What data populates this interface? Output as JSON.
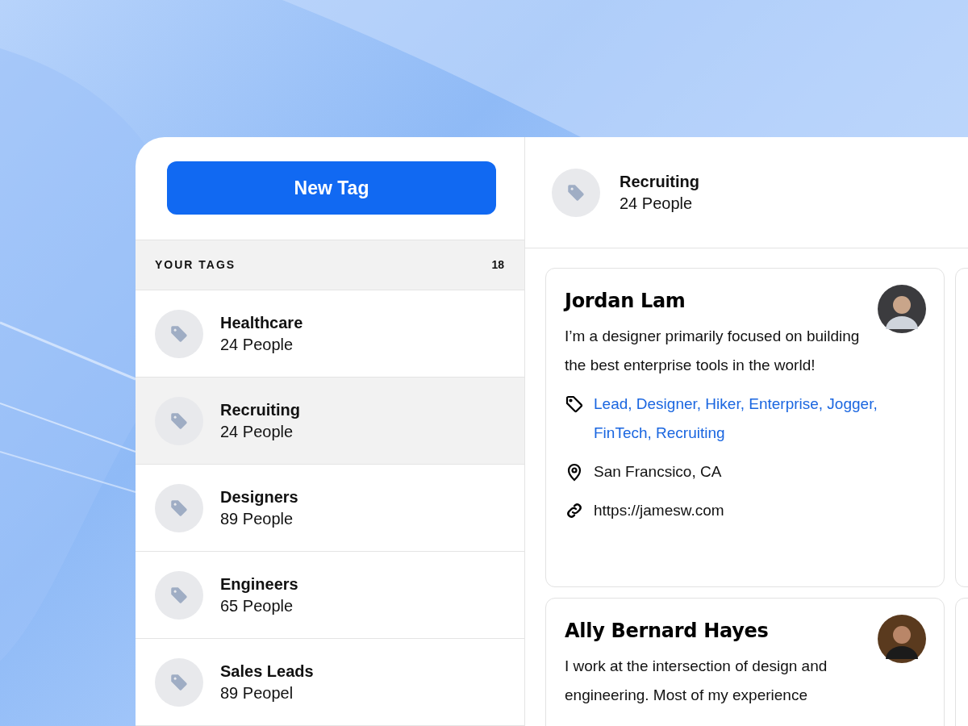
{
  "new_tag_button": "New Tag",
  "selected_tag": {
    "name": "Recruiting",
    "count": "24 People"
  },
  "tags_header": {
    "label": "YOUR TAGS",
    "count": "18"
  },
  "tags": [
    {
      "name": "Healthcare",
      "count": "24 People",
      "selected": false
    },
    {
      "name": "Recruiting",
      "count": "24 People",
      "selected": true
    },
    {
      "name": "Designers",
      "count": "89 People",
      "selected": false
    },
    {
      "name": "Engineers",
      "count": "65 People",
      "selected": false
    },
    {
      "name": "Sales Leads",
      "count": "89 Peopel",
      "selected": false
    }
  ],
  "people": [
    {
      "name": "Jordan Lam",
      "bio": "I’m a designer primarily focused on building the best enterprise tools in the world!",
      "tags": "Lead, Designer, Hiker, Enterprise, Jogger, FinTech, Recruiting",
      "location": "San Francsico, CA",
      "website": "https://jamesw.com"
    },
    {
      "name": "Ally Bernard Hayes",
      "bio": "I work at the intersection of design and engineering. Most of my experience"
    }
  ]
}
